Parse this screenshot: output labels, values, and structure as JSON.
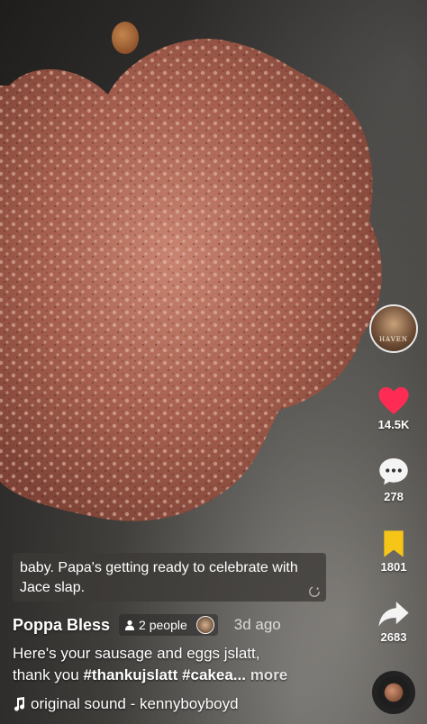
{
  "video": {
    "caption": "baby. Papa's getting ready to celebrate with Jace slap."
  },
  "creator": {
    "avatar_text": "HAVEN",
    "username": "Poppa Bless",
    "collab_label": "2 people",
    "posted": "3d ago"
  },
  "actions": {
    "likes": "14.5K",
    "comments": "278",
    "saves": "1801",
    "shares": "2683"
  },
  "description": {
    "text_1": "Here's your  sausage and eggs  jslatt,",
    "text_2": "thank you ",
    "tag_1": "#thankujslatt",
    "tag_2": "#cakea...",
    "more": "more"
  },
  "sound": {
    "label": "original sound - kennyboyboyd"
  },
  "colors": {
    "like": "#fe2c55",
    "save": "#f5c518",
    "caption_bg": "#3c3a37"
  }
}
